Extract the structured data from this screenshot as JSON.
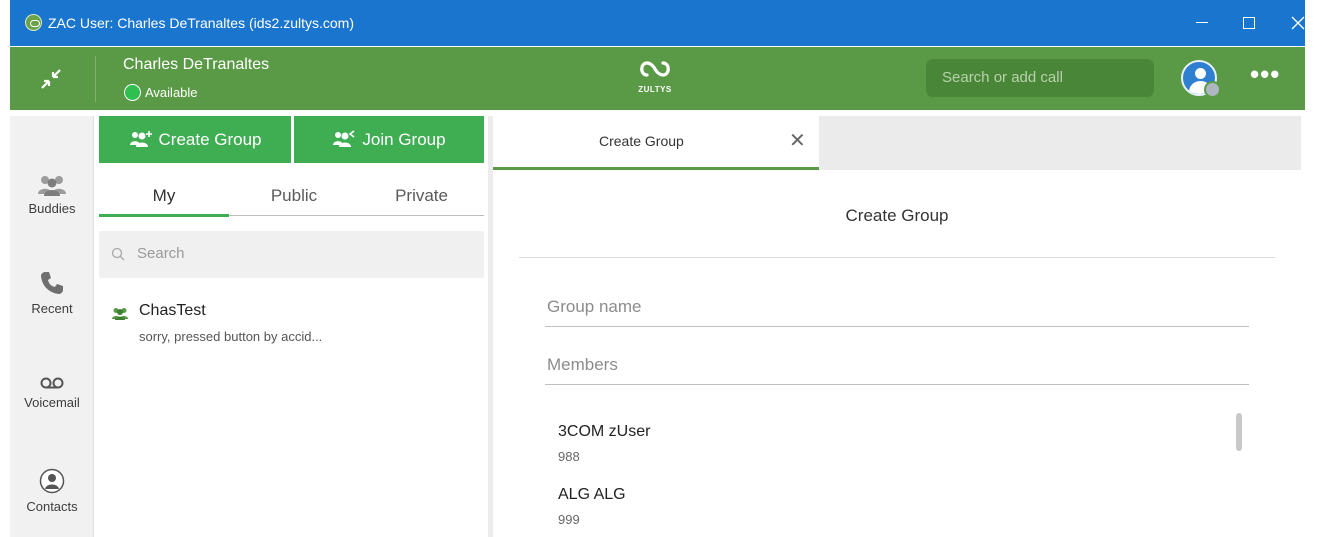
{
  "window": {
    "title": "ZAC User: Charles DeTranaltes (ids2.zultys.com)",
    "controls": {
      "minimize": "minimize-icon",
      "maximize": "maximize-icon",
      "close": "close-icon"
    }
  },
  "header": {
    "user_name": "Charles DeTranaltes",
    "status": "Available",
    "logo_text": "ZULTYS",
    "search_placeholder": "Search or add call",
    "more": "•••"
  },
  "nav": {
    "items": [
      {
        "label": "Buddies",
        "icon": "buddies-icon"
      },
      {
        "label": "Recent",
        "icon": "phone-icon"
      },
      {
        "label": "Voicemail",
        "icon": "voicemail-icon"
      },
      {
        "label": "Contacts",
        "icon": "contacts-icon"
      }
    ]
  },
  "groups": {
    "create_label": "Create Group",
    "join_label": "Join Group",
    "tabs": [
      "My",
      "Public",
      "Private"
    ],
    "active_tab": "My",
    "search_placeholder": "Search",
    "items": [
      {
        "name": "ChasTest",
        "last_message": "sorry, pressed button by accid..."
      }
    ]
  },
  "detail": {
    "tab_label": "Create Group",
    "title": "Create Group",
    "group_name_placeholder": "Group name",
    "members_placeholder": "Members",
    "members": [
      {
        "name": "3COM zUser",
        "ext": "988"
      },
      {
        "name": "ALG ALG",
        "ext": "999"
      }
    ]
  },
  "colors": {
    "titlebar": "#1a75cf",
    "header": "#5a9a46",
    "accent_green": "#3fae53",
    "status_available": "#2fbf4f"
  }
}
